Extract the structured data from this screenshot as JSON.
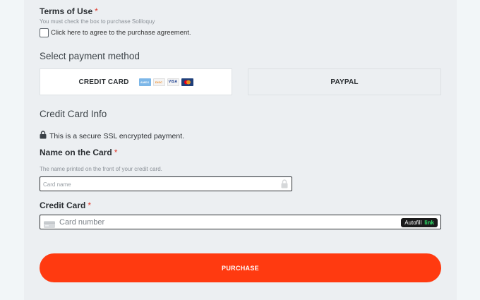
{
  "terms": {
    "label": "Terms of Use",
    "required_mark": "*",
    "hint": "You must check the box to purchase Soliloquy",
    "checkbox_label": "Click here to agree to the purchase agreement."
  },
  "payment_method": {
    "title": "Select payment method",
    "options": [
      {
        "label": "CREDIT CARD",
        "selected": true
      },
      {
        "label": "PAYPAL",
        "selected": false
      }
    ],
    "card_logos": [
      {
        "icon": "amex-card-icon",
        "text": "AMEX",
        "bg": "#7db7e8",
        "fg": "#ffffff"
      },
      {
        "icon": "discover-card-icon",
        "text": "DISC",
        "bg": "#f4f4f4",
        "fg": "#f08a24"
      },
      {
        "icon": "visa-card-icon",
        "text": "VISA",
        "bg": "#f4f4f4",
        "fg": "#1a3c8e"
      },
      {
        "icon": "mastercard-icon",
        "text": "",
        "bg": "#1f3f7a",
        "fg": "#ffffff"
      }
    ]
  },
  "card_info": {
    "title": "Credit Card Info",
    "secure_text": "This is a secure SSL encrypted payment.",
    "name_label": "Name on the Card",
    "name_required": "*",
    "name_hint": "The name printed on the front of your credit card.",
    "name_placeholder": "Card name",
    "card_label": "Credit Card",
    "card_required": "*",
    "card_placeholder": "Card number",
    "autofill_text": "Autofill",
    "autofill_link": "link"
  },
  "purchase_button": "PURCHASE",
  "colors": {
    "accent": "#ff3a10",
    "required": "#e23b2e",
    "autofill_link": "#2fe36b"
  }
}
